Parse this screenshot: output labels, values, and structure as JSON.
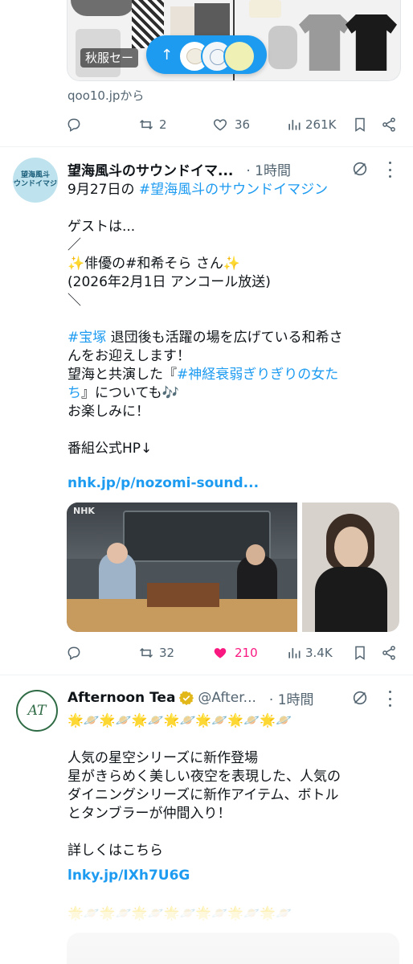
{
  "tweet1": {
    "card_sale_label": "秋服セー",
    "card_source": "qoo10.jpから",
    "actions": {
      "retweets": "2",
      "likes": "36",
      "views": "261K"
    }
  },
  "new_posts_pill": {
    "arrow": "↑"
  },
  "tweet2": {
    "avatar_text": "望海風斗\nサウンドイマジン",
    "name": "望海風斗のサウンドイマ...",
    "time": "· 1時間",
    "lines": [
      {
        "text": "9月27日の ",
        "tag": "#望海風斗のサウンドイマジン"
      },
      {
        "text": ""
      },
      {
        "text": "ゲストは..."
      },
      {
        "text": "／"
      },
      {
        "text": "✨俳優の#和希そら さん✨"
      },
      {
        "text": "(2026年2月1日 アンコール放送)"
      },
      {
        "text": "＼"
      },
      {
        "text": ""
      },
      {
        "tag": "#宝塚",
        "text": " 退団後も活躍の場を広げている和希さ"
      },
      {
        "text": "んをお迎えします！"
      },
      {
        "text": "望海と共演した『",
        "tag": "#神経衰弱ぎりぎりの女た"
      },
      {
        "tag": "ち",
        "text": "』についても🎶"
      },
      {
        "text": "お楽しみに！"
      },
      {
        "text": ""
      },
      {
        "text": "番組公式HP↓"
      }
    ],
    "url": "nhk.jp/p/nozomi-sound...",
    "photo_watermark": "NHK",
    "actions": {
      "retweets": "32",
      "likes": "210",
      "views": "3.4K"
    }
  },
  "tweet3": {
    "avatar_text": "AT",
    "name": "Afternoon Tea",
    "handle": "@After...",
    "time": "· 1時間",
    "emoji_row": "🌟🪐🌟🪐🌟🪐🌟🪐🌟🪐🌟🪐🌟🪐",
    "lines": [
      "人気の星空シリーズに新作登場",
      "星がきらめく美しい夜空を表現した、人気の",
      "ダイニングシリーズに新作アイテム、ボトル",
      "とタンブラーが仲間入り！",
      "",
      "詳しくはこちら"
    ],
    "url": "lnky.jp/IXh7U6G",
    "emoji_row2": "🌟🪐🌟🪐🌟🪐🌟🪐🌟🪐🌟🪐🌟🪐"
  },
  "colors": {
    "accent": "#1d9bf0",
    "like_active": "#f91880",
    "muted": "#536471",
    "verified_gold": "#e2b719"
  }
}
